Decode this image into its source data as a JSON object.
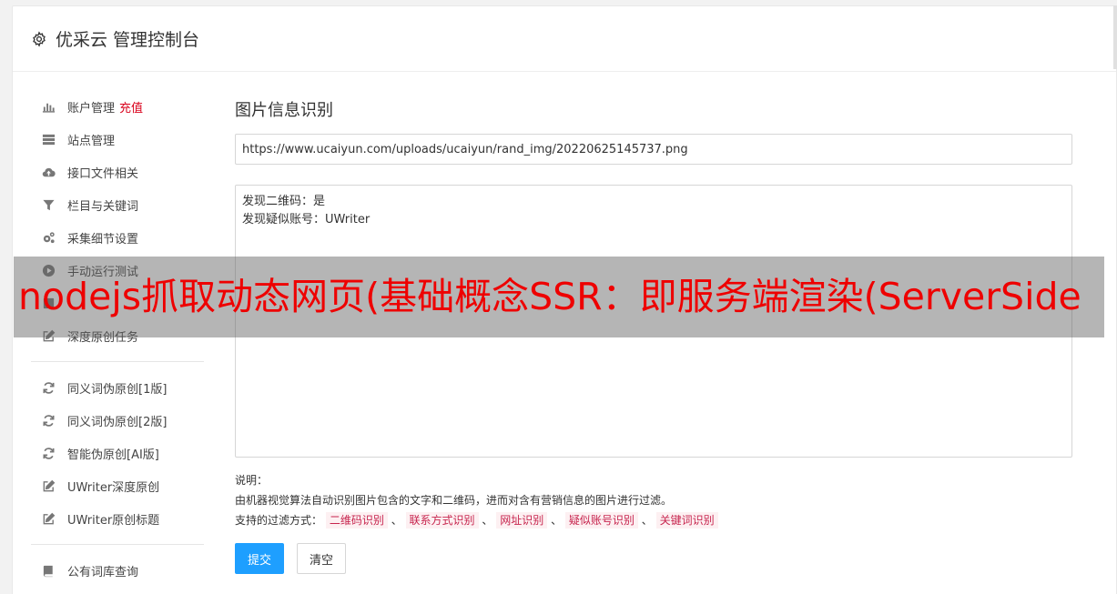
{
  "header": {
    "title": "优采云 管理控制台",
    "icon": "gear-icon"
  },
  "sidebar": {
    "account": {
      "label": "账户管理",
      "recharge": "充值",
      "icon": "bar-chart-icon"
    },
    "group1": [
      {
        "label": "站点管理",
        "icon": "server-icon"
      },
      {
        "label": "接口文件相关",
        "icon": "cloud-upload-icon"
      },
      {
        "label": "栏目与关键词",
        "icon": "filter-icon"
      },
      {
        "label": "采集细节设置",
        "icon": "gears-icon"
      },
      {
        "label": "手动运行测试",
        "icon": "play-icon"
      },
      {
        "label": "",
        "icon": "task-icon"
      },
      {
        "label": "深度原创任务",
        "icon": "edit-icon"
      }
    ],
    "group2": [
      {
        "label": "同义词伪原创[1版]",
        "icon": "refresh-icon"
      },
      {
        "label": "同义词伪原创[2版]",
        "icon": "refresh-icon"
      },
      {
        "label": "智能伪原创[AI版]",
        "icon": "refresh-icon"
      },
      {
        "label": "UWriter深度原创",
        "icon": "edit-icon"
      },
      {
        "label": "UWriter原创标题",
        "icon": "edit-icon"
      }
    ],
    "group3": [
      {
        "label": "公有词库查询",
        "icon": "book-icon"
      }
    ]
  },
  "main": {
    "title": "图片信息识别",
    "url_value": "https://www.ucaiyun.com/uploads/ucaiyun/rand_img/20220625145737.png",
    "result_lines": [
      "发现二维码：是",
      "发现疑似账号：UWriter"
    ],
    "desc_title": "说明：",
    "desc_text": "由机器视觉算法自动识别图片包含的文字和二维码，进而对含有营销信息的图片进行过滤。",
    "filter_label": "支持的过滤方式：",
    "filters": [
      "二维码识别",
      "联系方式识别",
      "网址识别",
      "疑似账号识别",
      "关键词识别"
    ],
    "separator": "、",
    "submit_label": "提交",
    "clear_label": "清空"
  },
  "overlay": {
    "text": "nodejs抓取动态网页(基础概念SSR：即服务端渲染(ServerSide"
  },
  "colors": {
    "accent": "#1e9fff",
    "recharge": "#d9001b",
    "tag_text": "#c7254e",
    "overlay_text": "#ee0000"
  }
}
